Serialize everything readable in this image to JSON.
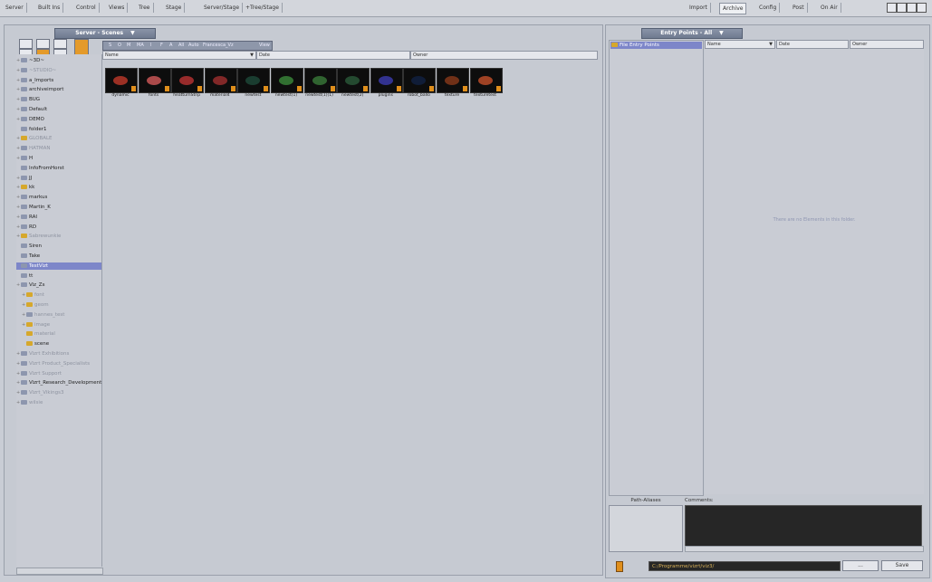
{
  "menu": {
    "left": [
      "Server",
      "Built Ins",
      "Control",
      "Views",
      "Tree",
      "Stage",
      "Server/Stage",
      "+Tree/Stage"
    ],
    "right": [
      "Import",
      "Archive",
      "Config",
      "Post",
      "On Air"
    ],
    "active": "Archive"
  },
  "left_panel": {
    "tab": "Server - Scenes",
    "filters": [
      "S",
      "O",
      "M",
      "MA",
      "I",
      "F",
      "A",
      "All",
      "Auto",
      "Francesca_Vz",
      "View"
    ],
    "columns": {
      "name": "Name",
      "date": "Date",
      "owner": "Owner"
    },
    "tree": [
      {
        "label": "~3D~",
        "dim": false,
        "expand": true,
        "color": "blue"
      },
      {
        "label": "~STUDIO~",
        "dim": true,
        "expand": true,
        "color": "blue"
      },
      {
        "label": "a_Imports",
        "dim": false,
        "expand": true,
        "color": "blue"
      },
      {
        "label": "archiveimport",
        "dim": false,
        "expand": true,
        "color": "blue"
      },
      {
        "label": "BUG",
        "dim": false,
        "expand": true,
        "color": "blue"
      },
      {
        "label": "Default",
        "dim": false,
        "expand": true,
        "color": "blue"
      },
      {
        "label": "DEMO",
        "dim": false,
        "expand": true,
        "color": "blue"
      },
      {
        "label": "folder1",
        "dim": false,
        "expand": false,
        "color": "blue"
      },
      {
        "label": "GLOBALE",
        "dim": true,
        "expand": true,
        "color": "yellow"
      },
      {
        "label": "HATMAN",
        "dim": true,
        "expand": true,
        "color": "blue"
      },
      {
        "label": "H",
        "dim": false,
        "expand": true,
        "color": "blue"
      },
      {
        "label": "InfoFromHorst",
        "dim": false,
        "expand": false,
        "color": "blue"
      },
      {
        "label": "JJ",
        "dim": false,
        "expand": true,
        "color": "blue"
      },
      {
        "label": "kk",
        "dim": false,
        "expand": true,
        "color": "yellow"
      },
      {
        "label": "markus",
        "dim": false,
        "expand": true,
        "color": "blue"
      },
      {
        "label": "Martin_K",
        "dim": false,
        "expand": true,
        "color": "blue"
      },
      {
        "label": "RAI",
        "dim": false,
        "expand": true,
        "color": "blue"
      },
      {
        "label": "RD",
        "dim": false,
        "expand": true,
        "color": "blue"
      },
      {
        "label": "Sabrewunkie",
        "dim": true,
        "expand": true,
        "color": "yellow"
      },
      {
        "label": "Siren",
        "dim": false,
        "expand": false,
        "color": "blue"
      },
      {
        "label": "Take",
        "dim": false,
        "expand": false,
        "color": "blue"
      },
      {
        "label": "TestVizt",
        "dim": false,
        "expand": false,
        "color": "blue",
        "selected": true
      },
      {
        "label": "tt",
        "dim": false,
        "expand": false,
        "color": "blue"
      },
      {
        "label": "Viz_Zs",
        "dim": false,
        "expand": true,
        "color": "blue"
      },
      {
        "label": "font",
        "dim": true,
        "expand": true,
        "color": "yellow",
        "indent": 1
      },
      {
        "label": "geom",
        "dim": true,
        "expand": true,
        "color": "yellow",
        "indent": 1
      },
      {
        "label": "hannes_test",
        "dim": true,
        "expand": true,
        "color": "blue",
        "indent": 1
      },
      {
        "label": "image",
        "dim": true,
        "expand": true,
        "color": "yellow",
        "indent": 1
      },
      {
        "label": "material",
        "dim": true,
        "expand": false,
        "color": "yellow",
        "indent": 1
      },
      {
        "label": "scene",
        "dim": false,
        "expand": false,
        "color": "yellow",
        "indent": 1
      },
      {
        "label": "Vizrt Exhibitions",
        "dim": true,
        "expand": true,
        "color": "blue"
      },
      {
        "label": "Vizrt Product_Specialists",
        "dim": true,
        "expand": true,
        "color": "blue"
      },
      {
        "label": "Vizrt Support",
        "dim": true,
        "expand": true,
        "color": "blue"
      },
      {
        "label": "Vizrt_Research_Development",
        "dim": false,
        "expand": true,
        "color": "blue"
      },
      {
        "label": "Vizrt_Vikings3",
        "dim": true,
        "expand": true,
        "color": "blue"
      },
      {
        "label": "wilsie",
        "dim": true,
        "expand": true,
        "color": "blue"
      }
    ],
    "items": [
      {
        "label": "dynamic",
        "color": "#c0392b"
      },
      {
        "label": "fonts",
        "color": "#d35a5a"
      },
      {
        "label": "heatturnStrip",
        "color": "#b33"
      },
      {
        "label": "material4",
        "color": "#a03030"
      },
      {
        "label": "newtest",
        "color": "#1e4a3a"
      },
      {
        "label": "newtest(1)",
        "color": "#3b8a3b"
      },
      {
        "label": "newtest(1)(1)",
        "color": "#3a7a3a"
      },
      {
        "label": "newtest(2)",
        "color": "#2a5a3a"
      },
      {
        "label": "plugins",
        "color": "#3c3cb0"
      },
      {
        "label": "robot_ballo",
        "color": "#112244"
      },
      {
        "label": "texture",
        "color": "#8a3a1a"
      },
      {
        "label": "texturetest",
        "color": "#c4502a"
      }
    ]
  },
  "right_panel": {
    "tab": "Entry Points - All",
    "tree_item": "File Entry Points",
    "columns": {
      "name": "Name",
      "date": "Date",
      "owner": "Owner"
    },
    "empty_message": "There are no Elements in this folder.",
    "path_aliases_label": "Path-Aliases",
    "comments_label": "Comments:",
    "path_value": "C:/Programme/vizrt/viz3/",
    "browse_label": "...",
    "save_label": "Save"
  }
}
